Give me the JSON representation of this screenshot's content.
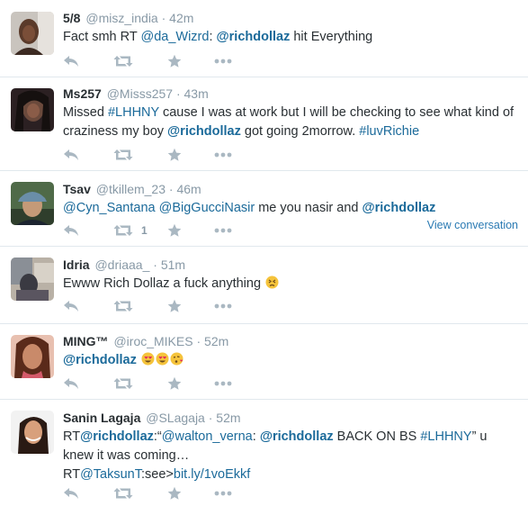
{
  "tweets": [
    {
      "name": "5/8",
      "handle": "@misz_india",
      "time": "42m",
      "text": [
        {
          "t": "Fact smh RT ",
          "k": "plain"
        },
        {
          "t": "@da_Wizrd",
          "k": "link"
        },
        {
          "t": ": ",
          "k": "plain"
        },
        {
          "t": "@richdollaz",
          "k": "mention"
        },
        {
          "t": " hit Everything",
          "k": "plain"
        }
      ]
    },
    {
      "name": "Ms257",
      "handle": "@Misss257",
      "time": "43m",
      "text": [
        {
          "t": "Missed ",
          "k": "plain"
        },
        {
          "t": "#LHHNY",
          "k": "hash"
        },
        {
          "t": " cause I was at work but I will be checking to see what kind of craziness my boy ",
          "k": "plain"
        },
        {
          "t": "@richdollaz",
          "k": "mention"
        },
        {
          "t": " got going 2morrow. ",
          "k": "plain"
        },
        {
          "t": "#luvRichie",
          "k": "hash"
        }
      ]
    },
    {
      "name": "Tsav",
      "handle": "@tkillem_23",
      "time": "46m",
      "text": [
        {
          "t": "@Cyn_Santana",
          "k": "link"
        },
        {
          "t": " ",
          "k": "plain"
        },
        {
          "t": "@BigGucciNasir",
          "k": "link"
        },
        {
          "t": " me you nasir and ",
          "k": "plain"
        },
        {
          "t": "@richdollaz",
          "k": "mention"
        }
      ],
      "retweet_count": "1",
      "view_conversation": "View conversation"
    },
    {
      "name": "Idria",
      "handle": "@driaaa_",
      "time": "51m",
      "text": [
        {
          "t": "Ewww Rich Dollaz a fuck anything ",
          "k": "plain"
        }
      ],
      "emoji": [
        "persevering-face"
      ]
    },
    {
      "name": "MING™",
      "handle": "@iroc_MIKES",
      "time": "52m",
      "text": [
        {
          "t": "@richdollaz",
          "k": "mention"
        },
        {
          "t": " ",
          "k": "plain"
        }
      ],
      "emoji": [
        "heart-eyes",
        "heart-eyes",
        "kissing-heart"
      ]
    },
    {
      "name": "Sanin Lagaja",
      "handle": "@SLagaja",
      "time": "52m",
      "text": [
        {
          "t": "RT",
          "k": "plain"
        },
        {
          "t": "@richdollaz",
          "k": "mention"
        },
        {
          "t": ":“",
          "k": "plain"
        },
        {
          "t": "@walton_verna",
          "k": "link"
        },
        {
          "t": ": ",
          "k": "plain"
        },
        {
          "t": "@richdollaz",
          "k": "mention"
        },
        {
          "t": " BACK ON BS ",
          "k": "plain"
        },
        {
          "t": "#LHHNY",
          "k": "hash"
        },
        {
          "t": "” u knew it was coming…",
          "k": "plain"
        },
        {
          "t": "\n RT",
          "k": "plain"
        },
        {
          "t": "@TaksunT",
          "k": "link"
        },
        {
          "t": ":see>",
          "k": "plain"
        },
        {
          "t": "bit.ly/1voEkkf",
          "k": "link"
        }
      ]
    }
  ]
}
